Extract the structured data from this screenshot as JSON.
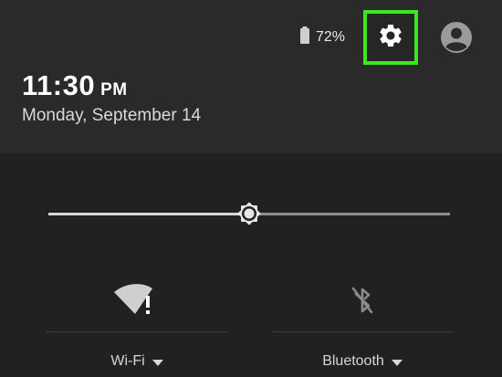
{
  "status_bar": {
    "battery_icon": "battery-icon",
    "battery_percent": "72%",
    "settings_icon": "gear-icon",
    "avatar_icon": "account-circle-icon",
    "highlight_color": "#39e81d"
  },
  "header": {
    "time": "11:30",
    "ampm": "PM",
    "date": "Monday, September 14"
  },
  "brightness": {
    "icon": "brightness-icon",
    "level": 0.5
  },
  "tiles": [
    {
      "icon": "wifi-alert-icon",
      "label": "Wi-Fi"
    },
    {
      "icon": "bluetooth-off-icon",
      "label": "Bluetooth"
    }
  ]
}
